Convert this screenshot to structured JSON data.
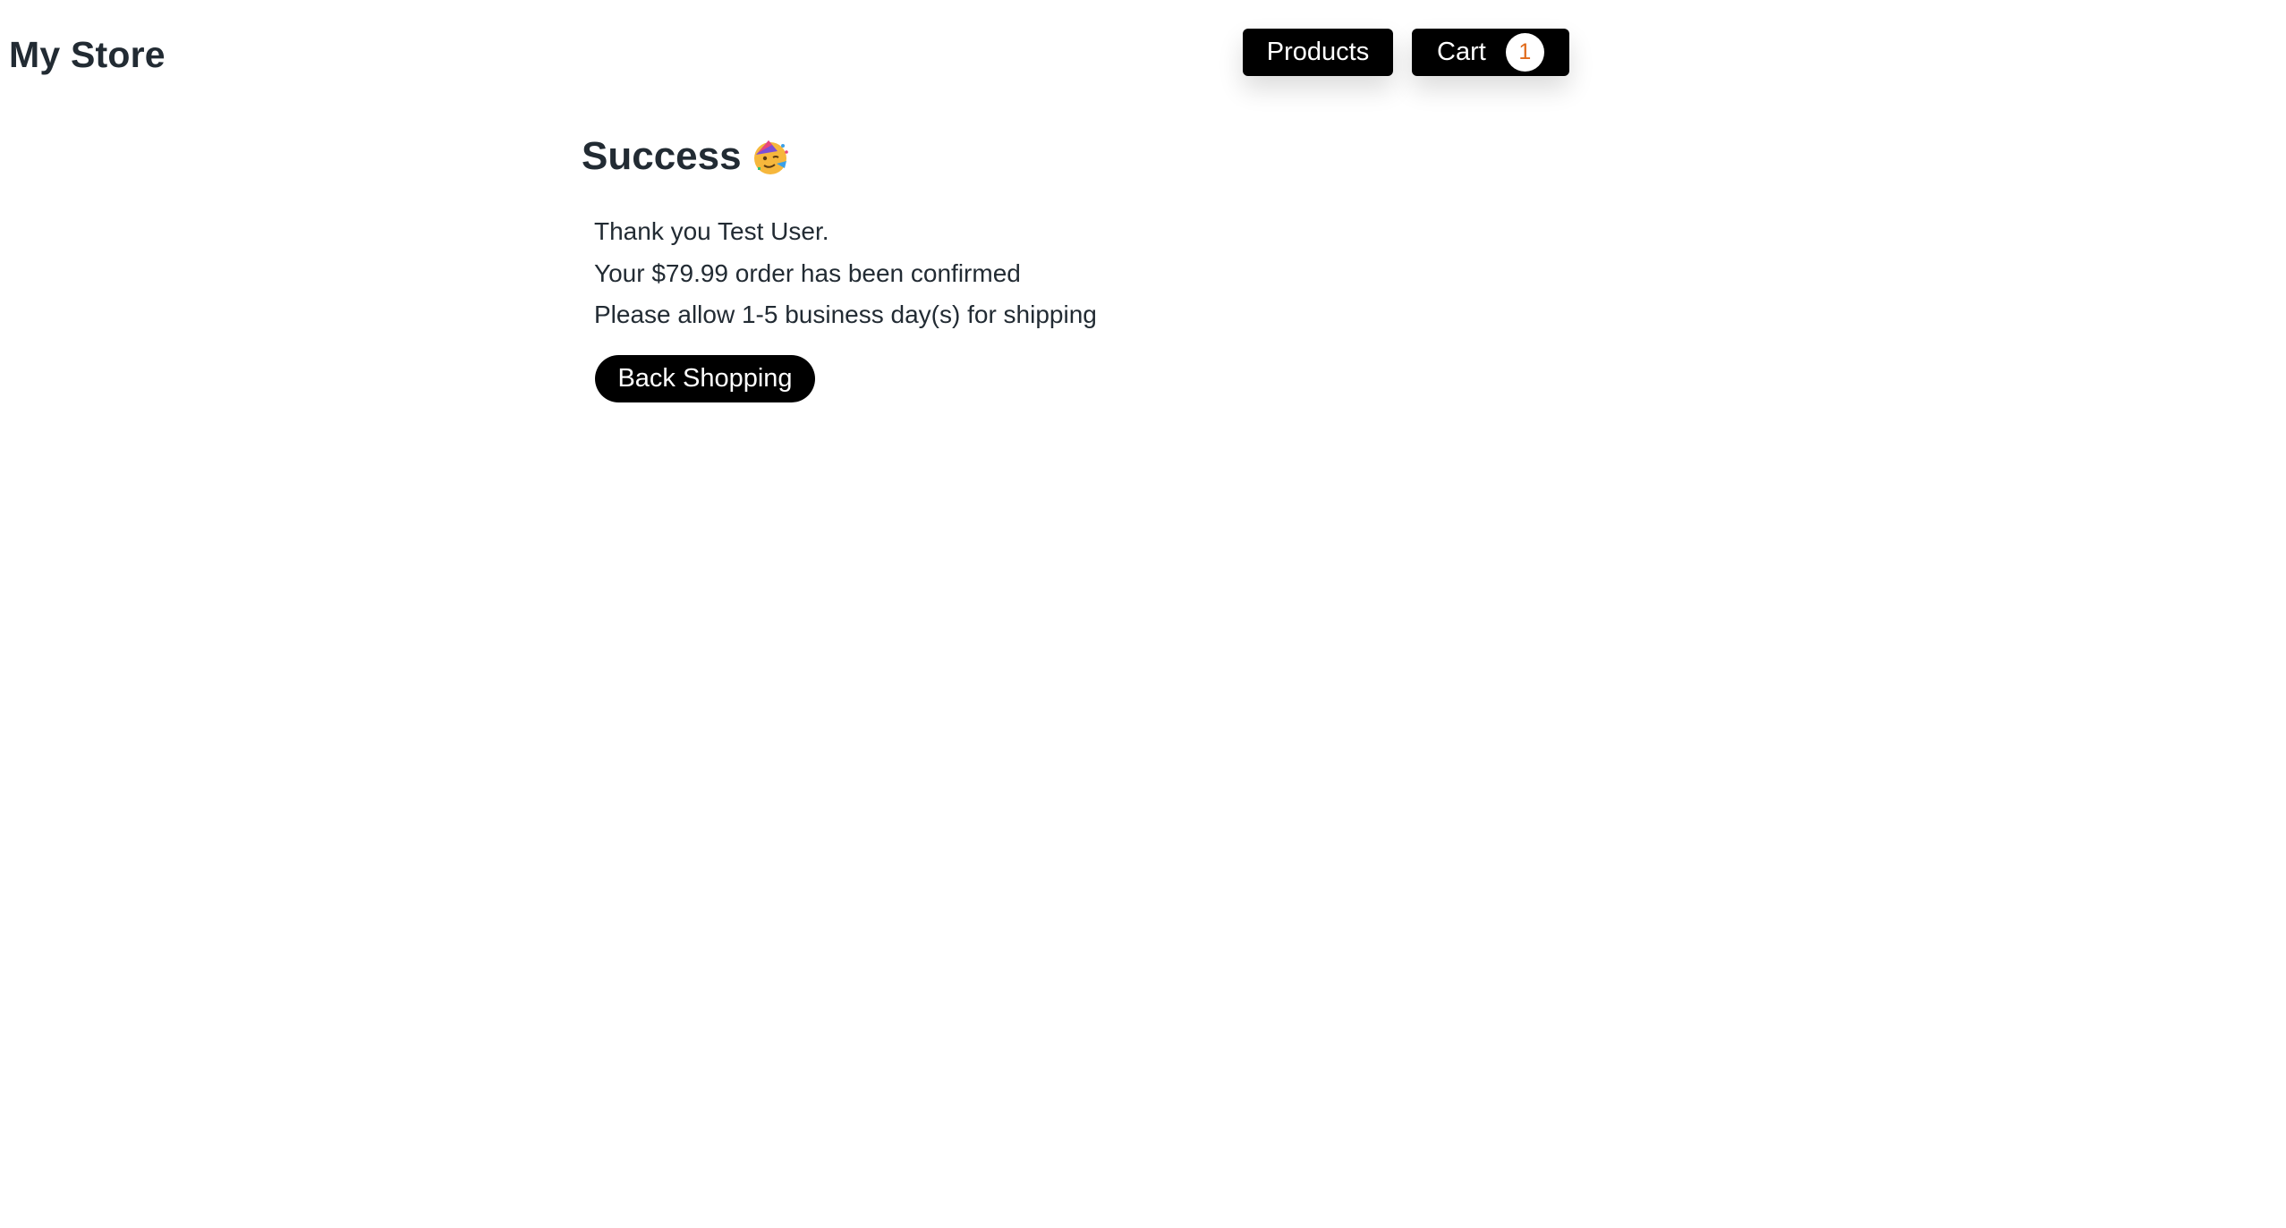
{
  "header": {
    "brand": "My Store",
    "nav": {
      "products_label": "Products",
      "cart_label": "Cart",
      "cart_count": "1"
    }
  },
  "success": {
    "title": "Success",
    "icon": "partying-face-icon",
    "lines": [
      "Thank you Test User.",
      "Your $79.99 order has been confirmed",
      "Please allow 1-5 business day(s) for shipping"
    ],
    "back_label": "Back Shopping"
  },
  "colors": {
    "text": "#222b33",
    "button_bg": "#000000",
    "button_text": "#ffffff",
    "badge_text": "#e06a1a"
  }
}
